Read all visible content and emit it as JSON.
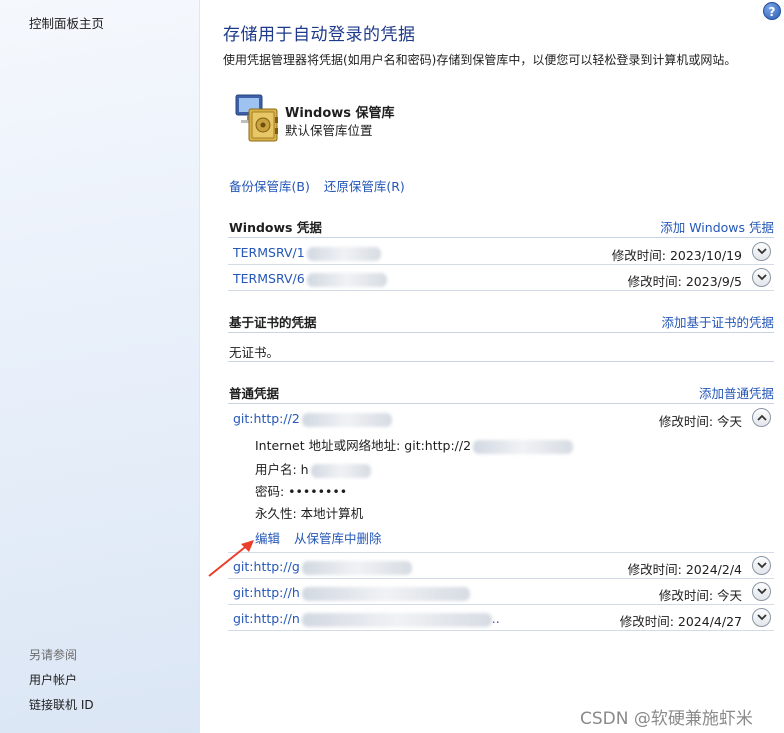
{
  "sidebar": {
    "home": "控制面板主页",
    "see_also": "另请参阅",
    "links": [
      "用户帐户",
      "链接联机 ID"
    ]
  },
  "header": {
    "title": "存储用于自动登录的凭据",
    "description": "使用凭据管理器将凭据(如用户名和密码)存储到保管库中，以便您可以轻松登录到计算机或网站。",
    "help": "?"
  },
  "vault": {
    "name": "Windows 保管库",
    "subtitle": "默认保管库位置",
    "backup": "备份保管库(B)",
    "restore": "还原保管库(R)"
  },
  "windows_credentials": {
    "title": "Windows 凭据",
    "add": "添加 Windows 凭据",
    "items": [
      {
        "name": "TERMSRV/1",
        "modified": "修改时间:  2023/10/19"
      },
      {
        "name": "TERMSRV/6",
        "modified": "修改时间:  2023/9/5"
      }
    ]
  },
  "certificate_credentials": {
    "title": "基于证书的凭据",
    "add": "添加基于证书的凭据",
    "empty": "无证书。"
  },
  "generic_credentials": {
    "title": "普通凭据",
    "add": "添加普通凭据",
    "expanded": {
      "name": "git:http://2",
      "modified": "修改时间:  今天",
      "address_label": "Internet 地址或网络地址:  git:http://2",
      "username_label": "用户名:  h",
      "password_label": "密码:  ••••••••",
      "persistence_label": "永久性:  本地计算机",
      "edit": "编辑",
      "remove": "从保管库中删除"
    },
    "items": [
      {
        "name": "git:http://g",
        "modified": "修改时间:  2024/2/4"
      },
      {
        "name": "git:http://h",
        "modified": "修改时间:  今天"
      },
      {
        "name": "git:http://n",
        "modified": "修改时间:  2024/4/27",
        "suffix": ".."
      }
    ]
  },
  "watermark": "CSDN @软硬兼施虾米",
  "colors": {
    "link": "#2457b8",
    "title": "#1e3a8a",
    "arrow": "#e8402a"
  }
}
